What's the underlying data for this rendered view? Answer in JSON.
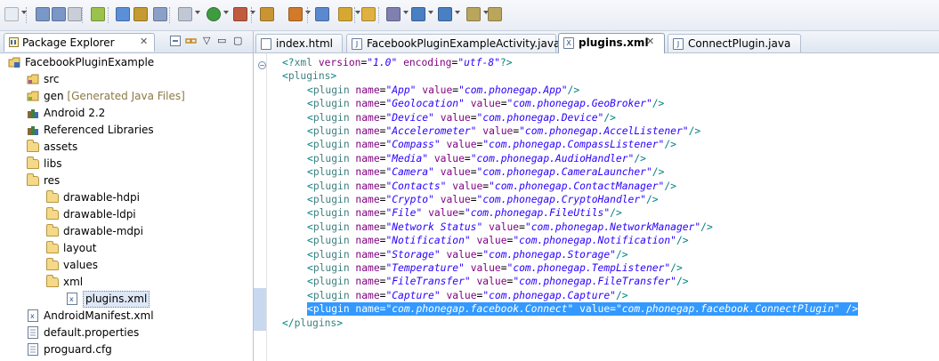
{
  "toolbar": {
    "icons": [
      "new-icon",
      "save-icon",
      "save-all-icon",
      "print-icon",
      "android-sdk-icon",
      "open-type-icon",
      "open-jar-icon",
      "open-resource-icon",
      "debug-icon",
      "run-icon",
      "external-tools-icon",
      "new-java-project-icon",
      "new-package-icon",
      "new-class-icon",
      "search-icon",
      "open-task-icon",
      "toggle-mark-icon",
      "next-annotation-icon",
      "previous-annotation-icon",
      "back-icon",
      "forward-icon"
    ]
  },
  "package_explorer": {
    "tab_label": "Package Explorer",
    "tree": [
      {
        "label": "FacebookPluginExample",
        "icon": "project-icon"
      },
      {
        "label": "src",
        "icon": "source-folder-icon"
      },
      {
        "label": "gen",
        "suffix": "[Generated Java Files]",
        "icon": "gen-folder-icon"
      },
      {
        "label": "Android 2.2",
        "icon": "library-icon"
      },
      {
        "label": "Referenced Libraries",
        "icon": "library-icon"
      },
      {
        "label": "assets",
        "icon": "folder-icon"
      },
      {
        "label": "libs",
        "icon": "folder-icon"
      },
      {
        "label": "res",
        "icon": "folder-icon"
      },
      {
        "label": "drawable-hdpi",
        "icon": "folder-icon"
      },
      {
        "label": "drawable-ldpi",
        "icon": "folder-icon"
      },
      {
        "label": "drawable-mdpi",
        "icon": "folder-icon"
      },
      {
        "label": "layout",
        "icon": "folder-icon"
      },
      {
        "label": "values",
        "icon": "folder-icon"
      },
      {
        "label": "xml",
        "icon": "folder-icon"
      },
      {
        "label": "plugins.xml",
        "icon": "xml-file-icon",
        "selected": true
      },
      {
        "label": "AndroidManifest.xml",
        "icon": "xml-file-icon"
      },
      {
        "label": "default.properties",
        "icon": "file-icon"
      },
      {
        "label": "proguard.cfg",
        "icon": "file-icon"
      }
    ]
  },
  "editor": {
    "tabs": [
      {
        "label": "index.html",
        "active": false
      },
      {
        "label": "FacebookPluginExampleActivity.java",
        "active": false
      },
      {
        "label": "plugins.xml",
        "active": true
      },
      {
        "label": "ConnectPlugin.java",
        "active": false
      }
    ],
    "xml_decl": {
      "version": "1.0",
      "encoding": "utf-8"
    },
    "root_tag": "plugins",
    "plugins": [
      {
        "name": "App",
        "value": "com.phonegap.App"
      },
      {
        "name": "Geolocation",
        "value": "com.phonegap.GeoBroker"
      },
      {
        "name": "Device",
        "value": "com.phonegap.Device"
      },
      {
        "name": "Accelerometer",
        "value": "com.phonegap.AccelListener"
      },
      {
        "name": "Compass",
        "value": "com.phonegap.CompassListener"
      },
      {
        "name": "Media",
        "value": "com.phonegap.AudioHandler"
      },
      {
        "name": "Camera",
        "value": "com.phonegap.CameraLauncher"
      },
      {
        "name": "Contacts",
        "value": "com.phonegap.ContactManager"
      },
      {
        "name": "Crypto",
        "value": "com.phonegap.CryptoHandler"
      },
      {
        "name": "File",
        "value": "com.phonegap.FileUtils"
      },
      {
        "name": "Network Status",
        "value": "com.phonegap.NetworkManager"
      },
      {
        "name": "Notification",
        "value": "com.phonegap.Notification"
      },
      {
        "name": "Storage",
        "value": "com.phonegap.Storage"
      },
      {
        "name": "Temperature",
        "value": "com.phonegap.TempListener"
      },
      {
        "name": "FileTransfer",
        "value": "com.phonegap.FileTransfer"
      },
      {
        "name": "Capture",
        "value": "com.phonegap.Capture"
      },
      {
        "name": "com.phonegap.facebook.Connect",
        "value": "com.phonegap.facebook.ConnectPlugin",
        "selected": true
      }
    ]
  },
  "colors": {
    "tag": "#3f7f7f",
    "attr": "#7f007f",
    "value": "#2a00ff",
    "selection": "#3399ff"
  }
}
